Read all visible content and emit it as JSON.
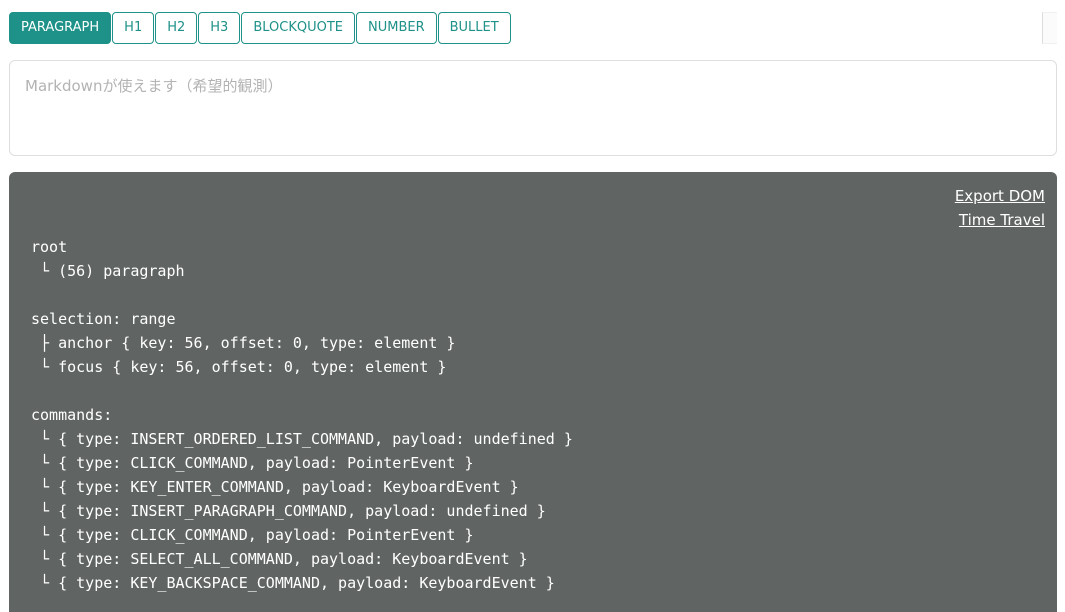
{
  "toolbar": {
    "buttons": [
      {
        "label": "PARAGRAPH",
        "active": true
      },
      {
        "label": "H1",
        "active": false
      },
      {
        "label": "H2",
        "active": false
      },
      {
        "label": "H3",
        "active": false
      },
      {
        "label": "BLOCKQUOTE",
        "active": false
      },
      {
        "label": "NUMBER",
        "active": false
      },
      {
        "label": "BULLET",
        "active": false
      }
    ]
  },
  "editor": {
    "placeholder": "Markdownが使えます（希望的観測）"
  },
  "tree_view": {
    "export_label": "Export DOM",
    "time_travel_label": "Time Travel",
    "lines": [
      "root",
      " └ (56) paragraph",
      "",
      "selection: range",
      " ├ anchor { key: 56, offset: 0, type: element }",
      " └ focus { key: 56, offset: 0, type: element }",
      "",
      "commands:",
      " └ { type: INSERT_ORDERED_LIST_COMMAND, payload: undefined }",
      " └ { type: CLICK_COMMAND, payload: PointerEvent }",
      " └ { type: KEY_ENTER_COMMAND, payload: KeyboardEvent }",
      " └ { type: INSERT_PARAGRAPH_COMMAND, payload: undefined }",
      " └ { type: CLICK_COMMAND, payload: PointerEvent }",
      " └ { type: SELECT_ALL_COMMAND, payload: KeyboardEvent }",
      " └ { type: KEY_BACKSPACE_COMMAND, payload: KeyboardEvent }"
    ]
  },
  "colors": {
    "accent": "#1e9188",
    "tree_view_bg": "#606563",
    "placeholder": "#b3b3b3"
  }
}
